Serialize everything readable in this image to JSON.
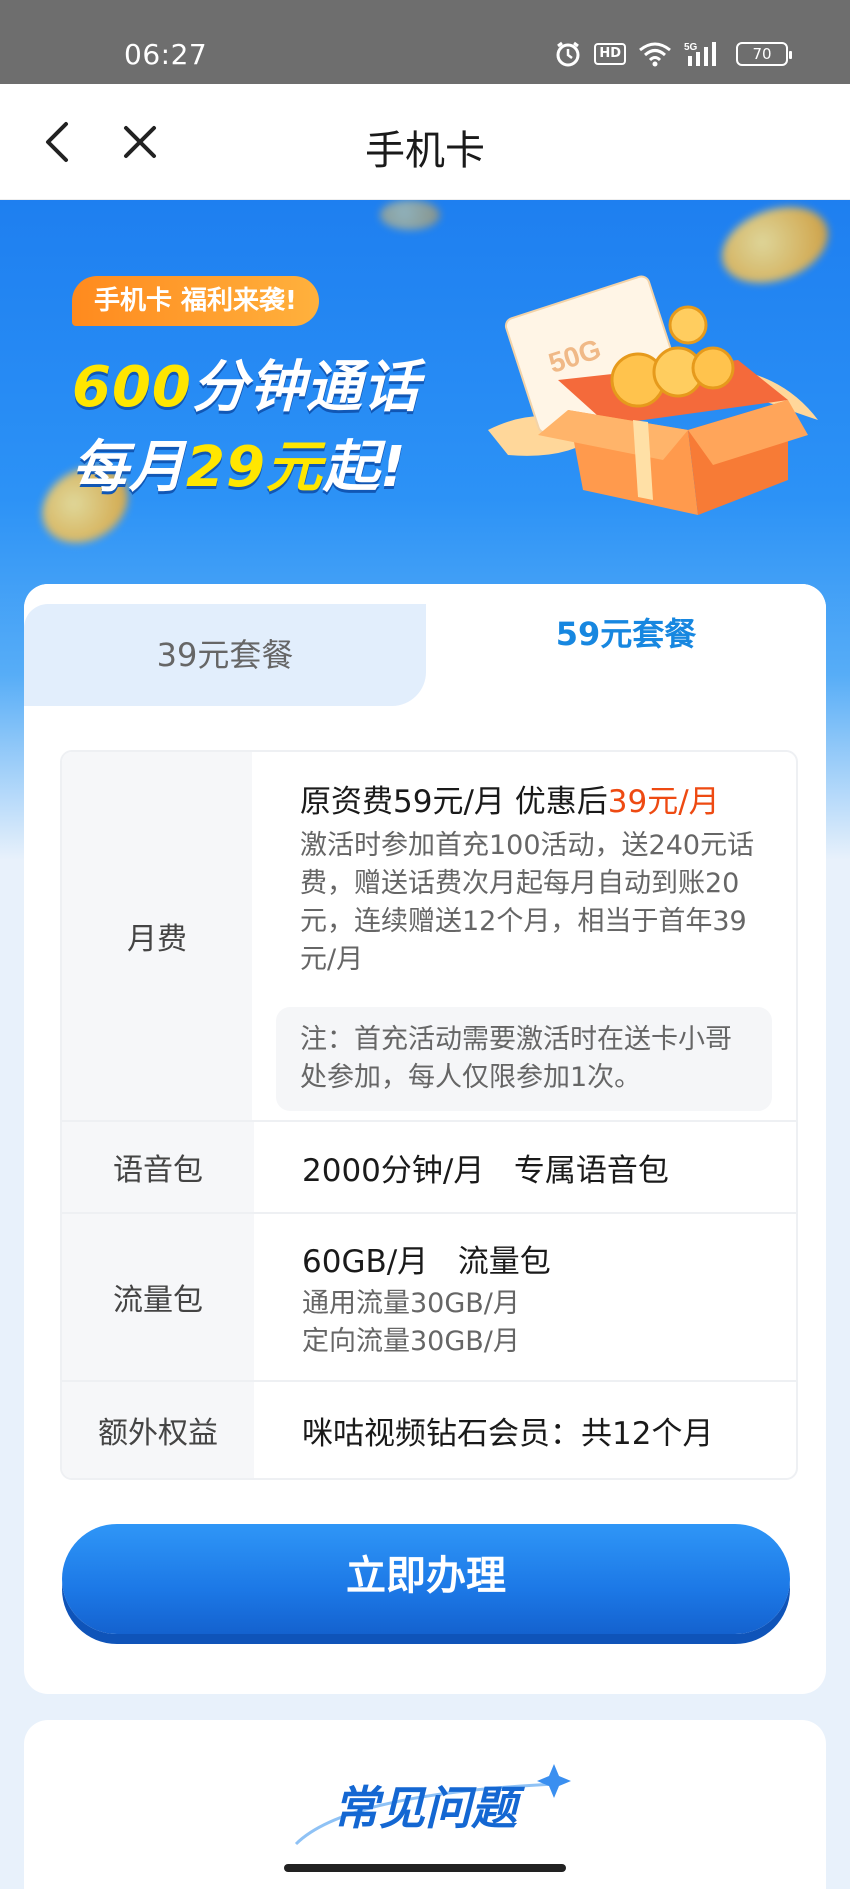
{
  "status_bar": {
    "time": "06:27",
    "hd": "HD",
    "network": "5G",
    "battery": "70"
  },
  "nav": {
    "title": "手机卡"
  },
  "banner": {
    "tag": "手机卡 福利来袭!",
    "line1_highlight": "600",
    "line1_rest": "分钟通话",
    "line2_pre": "每月",
    "line2_highlight": "29元",
    "line2_post": "起!",
    "gift_label": "50G"
  },
  "tabs": [
    {
      "label": "39元套餐",
      "active": false
    },
    {
      "label": "59元套餐",
      "active": true
    }
  ],
  "plan": {
    "monthly_fee": {
      "label": "月费",
      "main_prefix": "原资费59元/月 优惠后",
      "main_highlight": "39元/月",
      "detail": "激活时参加首充100活动，送240元话费，赠送话费次月起每月自动到账20元，连续赠送12个月，相当于首年39元/月",
      "note": "注：首充活动需要激活时在送卡小哥处参加，每人仅限参加1次。"
    },
    "voice": {
      "label": "语音包",
      "main": "2000分钟/月   专属语音包"
    },
    "data": {
      "label": "流量包",
      "main": "60GB/月   流量包",
      "line1": "通用流量30GB/月",
      "line2": "定向流量30GB/月"
    },
    "extra": {
      "label": "额外权益",
      "main": "咪咕视频钻石会员：共12个月"
    }
  },
  "cta_label": "立即办理",
  "faq_title": "常见问题",
  "colors": {
    "accent_blue": "#1787e0",
    "price_red": "#ee4a12",
    "tag_orange": "#ff8a1e",
    "highlight_yellow": "#ffe600"
  }
}
